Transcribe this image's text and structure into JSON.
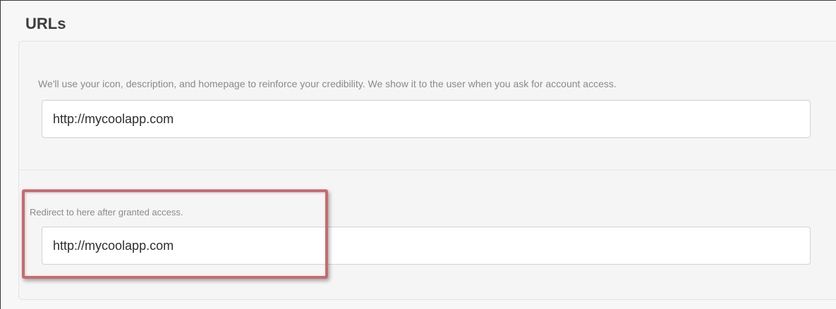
{
  "section": {
    "title": "URLs"
  },
  "website_field": {
    "help_text": "We'll use your icon, description, and homepage to reinforce your credibility. We show it to the user when you ask for account access.",
    "value": "http://mycoolapp.com"
  },
  "callback_field": {
    "help_text": "Redirect to here after granted access.",
    "value": "http://mycoolapp.com"
  },
  "annotation": {
    "highlight_color": "#c96a6f"
  },
  "colors": {
    "panel_background": "#f5f5f5",
    "panel_border": "#e3e3e3",
    "input_border": "#d2d2d2",
    "help_text": "#8a8a8a",
    "title_text": "#3d3d3d"
  }
}
